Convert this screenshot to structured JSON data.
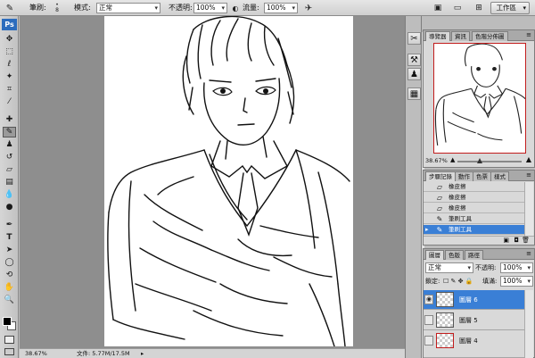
{
  "options_bar": {
    "brush_label": "筆刷:",
    "brush_size": "8",
    "mode_label": "模式:",
    "mode_value": "正常",
    "opacity_label": "不透明:",
    "opacity_value": "100%",
    "flow_label": "流量:",
    "flow_value": "100%",
    "workspace_label": "工作區"
  },
  "tools": {
    "logo": "Ps",
    "items": [
      "move",
      "marquee",
      "lasso",
      "magic-wand",
      "crop",
      "eyedropper",
      "healing",
      "brush",
      "stamp",
      "history-brush",
      "eraser",
      "gradient",
      "blur",
      "dodge",
      "pen",
      "type",
      "path-select",
      "shape",
      "hand",
      "zoom"
    ],
    "selected": "brush"
  },
  "status_bar": {
    "zoom": "38.67%",
    "doc_info": "文件: 5.77M/17.5M"
  },
  "navigator": {
    "tabs": [
      "導覽器",
      "資訊",
      "色階分佈圖"
    ],
    "zoom": "38.67%"
  },
  "history": {
    "tabs": [
      "步驟記錄",
      "動作",
      "色票",
      "樣式"
    ],
    "items": [
      {
        "icon": "eraser-icon",
        "label": "橡皮擦"
      },
      {
        "icon": "eraser-icon",
        "label": "橡皮擦"
      },
      {
        "icon": "eraser-icon",
        "label": "橡皮擦"
      },
      {
        "icon": "brush-icon",
        "label": "筆刷工具"
      },
      {
        "icon": "brush-icon",
        "label": "筆刷工具"
      }
    ]
  },
  "layers": {
    "tabs": [
      "圖層",
      "色版",
      "路徑"
    ],
    "blend_mode": "正常",
    "opacity_label": "不透明:",
    "opacity_value": "100%",
    "lock_label": "鎖定:",
    "fill_label": "填滿:",
    "fill_value": "100%",
    "items": [
      {
        "name": "圖層 6",
        "visible": true
      },
      {
        "name": "圖層 5",
        "visible": false
      },
      {
        "name": "圖層 4",
        "visible": false
      }
    ]
  },
  "colors": {
    "selection": "#3a7fd6",
    "nav_frame": "#c21d1d",
    "panel": "#d9d9d9"
  }
}
